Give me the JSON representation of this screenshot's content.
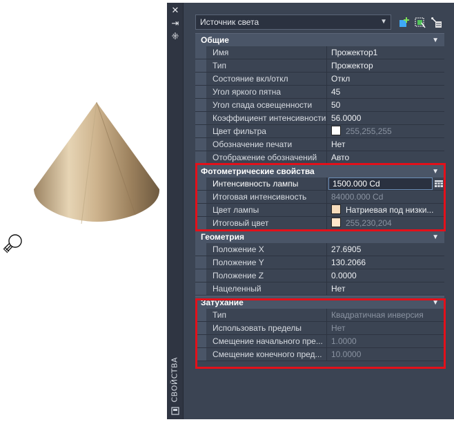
{
  "palette": {
    "side_title": "СВОЙСТВА",
    "selector": {
      "value": "Источник света"
    },
    "sections": [
      {
        "title": "Общие",
        "rows": [
          {
            "name": "Имя",
            "value": "Прожектор1"
          },
          {
            "name": "Тип",
            "value": "Прожектор"
          },
          {
            "name": "Состояние вкл/откл",
            "value": "Откл"
          },
          {
            "name": "Угол яркого пятна",
            "value": "45"
          },
          {
            "name": "Угол спада освещенности",
            "value": "50"
          },
          {
            "name": "Коэффициент интенсивности",
            "value": "56.0000"
          },
          {
            "name": "Цвет фильтра",
            "value": "255,255,255",
            "swatch": "#ffffff",
            "dim": true
          },
          {
            "name": "Обозначение печати",
            "value": "Нет"
          },
          {
            "name": "Отображение обозначений",
            "value": "Авто"
          }
        ]
      },
      {
        "title": "Фотометрические свойства",
        "rows": [
          {
            "name": "Интенсивность лампы",
            "value": "1500.000 Cd",
            "editing": true
          },
          {
            "name": "Итоговая интенсивность",
            "value": "84000.000 Cd",
            "dim": true
          },
          {
            "name": "Цвет лампы",
            "value": "Натриевая под низки...",
            "swatch": "#f6dcbc"
          },
          {
            "name": "Итоговый цвет",
            "value": "255,230,204",
            "swatch": "#ffe6cc",
            "dim": true
          }
        ]
      },
      {
        "title": "Геометрия",
        "rows": [
          {
            "name": "Положение X",
            "value": "27.6905"
          },
          {
            "name": "Положение Y",
            "value": "130.2066"
          },
          {
            "name": "Положение Z",
            "value": "0.0000"
          },
          {
            "name": "Нацеленный",
            "value": "Нет"
          }
        ]
      },
      {
        "title": "Затухание",
        "rows": [
          {
            "name": "Тип",
            "value": "Квадратичная инверсия",
            "dim": true
          },
          {
            "name": "Использовать пределы",
            "value": "Нет",
            "dim": true
          },
          {
            "name": "Смещение начального пре...",
            "value": "1.0000",
            "dim": true
          },
          {
            "name": "Смещение конечного пред...",
            "value": "10.0000",
            "dim": true
          }
        ]
      }
    ]
  },
  "colors": {
    "panel_bg": "#3b4453",
    "category_bg": "#4a5567",
    "highlight": "#e3101a"
  }
}
